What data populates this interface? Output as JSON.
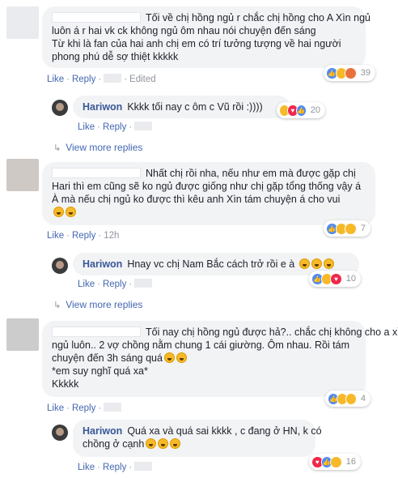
{
  "colors": {
    "link": "#4267b2",
    "author": "#385898",
    "meta": "#90949c",
    "bubble": "#f2f3f5"
  },
  "actions": {
    "like": "Like",
    "reply": "Reply",
    "separator": "·"
  },
  "comments": [
    {
      "lines": [
        "Tối về chị hồng ngủ r chắc chị hồng cho A Xìn ngủ",
        "luôn á r hai vk ck không ngủ ôm nhau nói chuyện đến sáng",
        "Từ khi là fan của hai anh chị em có trí tưởng tượng về hai người",
        "phong phú dễ sợ thiệt kkkkk"
      ],
      "meta": "Edited",
      "reaction_icons": [
        "like-reaction-icon",
        "haha-reaction-icon",
        "angry-reaction-icon"
      ],
      "reaction_count": "39",
      "reply": {
        "author": "Hariwon",
        "text": "Kkkk tối nay c ôm c Vũ rồi :))))",
        "reaction_icons": [
          "haha-reaction-icon",
          "love-reaction-icon",
          "like-reaction-icon"
        ],
        "reaction_count": "20"
      },
      "view_more": "View more replies"
    },
    {
      "lines": [
        "Nhất chị rồi nha, nếu như em mà được gặp chị",
        "Hari thì em cũng sẽ ko ngủ được giống như chị gặp tổng thống vậy á",
        "À mà nếu chị ngủ ko được thì kêu anh Xìn tám chuyện á cho vui"
      ],
      "meta": "12h",
      "reaction_icons": [
        "like-reaction-icon",
        "wow-reaction-icon",
        "sad-reaction-icon"
      ],
      "reaction_count": "7",
      "reply": {
        "author": "Hariwon",
        "text": "Hnay vc chị Nam Bắc cách trở rồi e à",
        "reaction_icons": [
          "like-reaction-icon",
          "haha-reaction-icon",
          "love-reaction-icon"
        ],
        "reaction_count": "10"
      },
      "view_more": "View more replies"
    },
    {
      "lines": [
        "Tối nay chị hồng ngủ được hả?.. chắc chị không cho a xìn",
        "ngủ luôn.. 2 vợ chồng nằm chung 1 cái giường. Ôm nhau. Rồi tám",
        "chuyện đến 3h sáng quá",
        "*em suy nghĩ quá xa*",
        "Kkkkk"
      ],
      "meta": "",
      "reaction_icons": [
        "like-reaction-icon",
        "wow-reaction-icon",
        "haha-reaction-icon"
      ],
      "reaction_count": "4",
      "reply": {
        "author": "Hariwon",
        "text": "Quá xa và quá sai kkkk , c đang ở HN, k có",
        "text2": "chồng ở cạnh",
        "reaction_icons": [
          "love-reaction-icon",
          "like-reaction-icon",
          "haha-reaction-icon"
        ],
        "reaction_count": "16"
      }
    }
  ]
}
